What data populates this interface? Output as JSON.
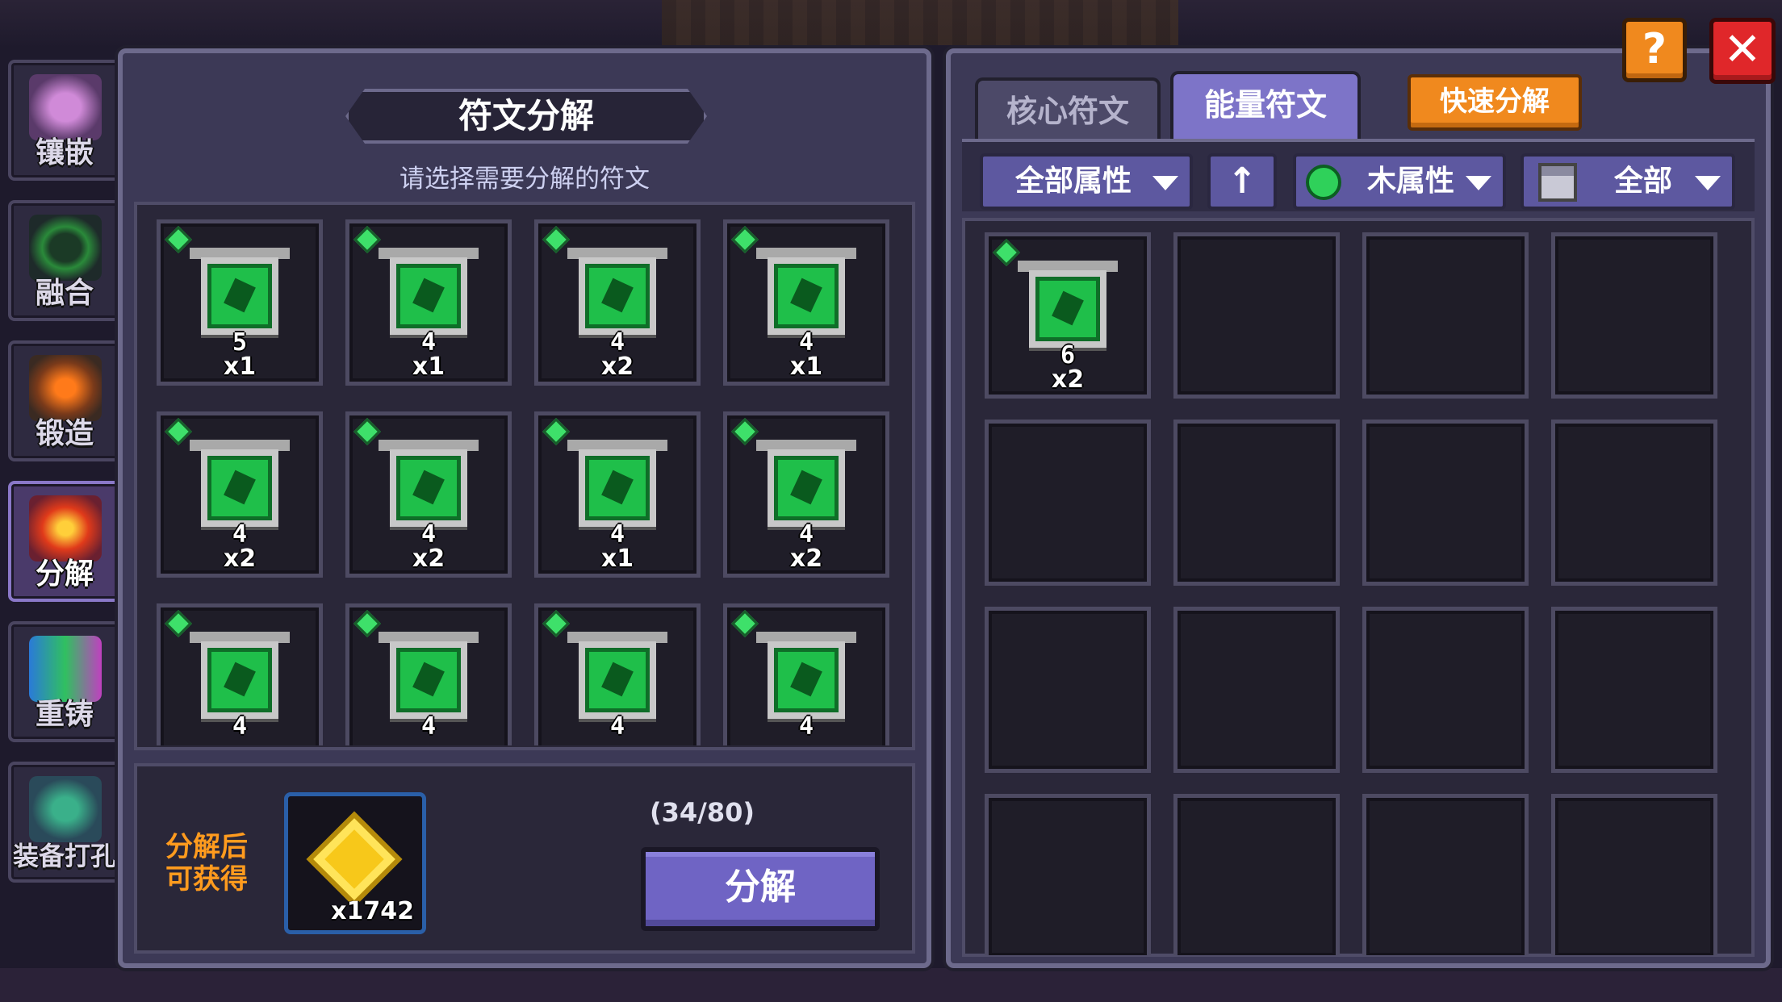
{
  "sidebar": {
    "items": [
      {
        "label": "镶嵌",
        "icon": "inlay-icon",
        "active": false
      },
      {
        "label": "融合",
        "icon": "fusion-icon",
        "active": false
      },
      {
        "label": "锻造",
        "icon": "forge-icon",
        "active": false
      },
      {
        "label": "分解",
        "icon": "decompose-icon",
        "active": true
      },
      {
        "label": "重铸",
        "icon": "recast-icon",
        "active": false
      },
      {
        "label": "装备打孔",
        "icon": "socket-icon",
        "active": false
      }
    ]
  },
  "left_panel": {
    "title": "符文分解",
    "subtitle": "请选择需要分解的符文",
    "runes": [
      {
        "level": "5",
        "count": "x1"
      },
      {
        "level": "4",
        "count": "x1"
      },
      {
        "level": "4",
        "count": "x2"
      },
      {
        "level": "4",
        "count": "x1"
      },
      {
        "level": "4",
        "count": "x2"
      },
      {
        "level": "4",
        "count": "x2"
      },
      {
        "level": "4",
        "count": "x1"
      },
      {
        "level": "4",
        "count": "x2"
      },
      {
        "level": "4",
        "count": ""
      },
      {
        "level": "4",
        "count": ""
      },
      {
        "level": "4",
        "count": ""
      },
      {
        "level": "4",
        "count": ""
      }
    ],
    "reward_label": "分解后可获得",
    "reward_amount": "x1742",
    "capacity": "(34/80)",
    "decompose_button": "分解"
  },
  "right_panel": {
    "tabs": [
      {
        "label": "核心符文",
        "active": false
      },
      {
        "label": "能量符文",
        "active": true
      }
    ],
    "quick_decompose": "快速分解",
    "filters": {
      "attribute_all": "全部属性",
      "sort_icon": "↑",
      "element": "木属性",
      "type": "全部"
    },
    "inventory": [
      {
        "level": "6",
        "count": "x2",
        "filled": true
      }
    ]
  },
  "buttons": {
    "help": "?",
    "close": "✕"
  },
  "colors": {
    "accent": "#7d74c8",
    "orange": "#f0891e",
    "red": "#e0272a",
    "rune_green": "#1fbf4a",
    "reward_label": "#ff9b1e"
  }
}
